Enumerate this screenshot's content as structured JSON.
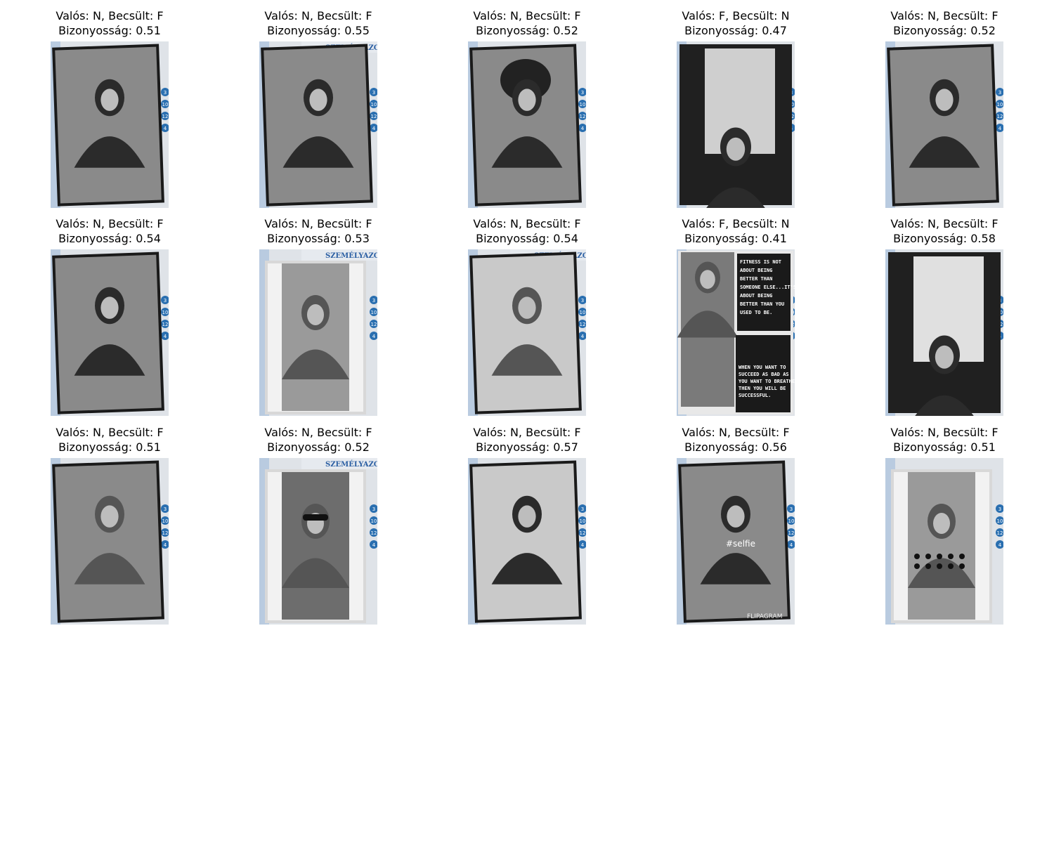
{
  "grid": {
    "rows": 3,
    "columns": 5,
    "items": [
      {
        "line1": "Valós: N, Becsült: F",
        "line2": "Bizonyosság: 0.51",
        "variant": "dark-hair-side"
      },
      {
        "line1": "Valós: N, Becsült: F",
        "line2": "Bizonyosság: 0.55",
        "variant": "id-header",
        "header": "SZEMÉLYAZONO"
      },
      {
        "line1": "Valós: N, Becsült: F",
        "line2": "Bizonyosság: 0.52",
        "variant": "hat"
      },
      {
        "line1": "Valós: F, Becsült: N",
        "line2": "Bizonyosság: 0.47",
        "variant": "window-light"
      },
      {
        "line1": "Valós: N, Becsült: F",
        "line2": "Bizonyosság: 0.52",
        "variant": "mirror-full"
      },
      {
        "line1": "Valós: N, Becsült: F",
        "line2": "Bizonyosság: 0.54",
        "variant": "lying"
      },
      {
        "line1": "Valós: N, Becsült: F",
        "line2": "Bizonyosság: 0.53",
        "variant": "id-header-white",
        "header": "SZEMÉLYAZONO"
      },
      {
        "line1": "Valós: N, Becsült: F",
        "line2": "Bizonyosság: 0.54",
        "variant": "blonde",
        "header": "SZEMÉLYAZONO"
      },
      {
        "line1": "Valós: F, Becsült: N",
        "line2": "Bizonyosság: 0.41",
        "variant": "poster",
        "poster_top": [
          "FITNESS IS NOT",
          "ABOUT BEING",
          "BETTER THAN",
          "SOMEONE ELSE...IT'S",
          "ABOUT BEING",
          "BETTER THAN YOU",
          "USED TO BE."
        ],
        "poster_bottom": [
          "WHEN YOU WANT TO",
          "SUCCEED AS BAD AS",
          "YOU WANT TO BREATHE,",
          "THEN YOU WILL BE",
          "SUCCESSFUL."
        ]
      },
      {
        "line1": "Valós: N, Becsült: F",
        "line2": "Bizonyosság: 0.58",
        "variant": "backlit"
      },
      {
        "line1": "Valós: N, Becsült: F",
        "line2": "Bizonyosság: 0.51",
        "variant": "portrait-frame"
      },
      {
        "line1": "Valós: N, Becsült: F",
        "line2": "Bizonyosság: 0.52",
        "variant": "sunglasses",
        "header": "SZEMÉLYAZONO"
      },
      {
        "line1": "Valós: N, Becsült: F",
        "line2": "Bizonyosság: 0.57",
        "variant": "lace"
      },
      {
        "line1": "Valós: N, Becsült: F",
        "line2": "Bizonyosság: 0.56",
        "variant": "child",
        "caption": "#selfie",
        "watermark": "FLIPAGRAM"
      },
      {
        "line1": "Valós: N, Becsült: F",
        "line2": "Bizonyosság: 0.51",
        "variant": "mirror-dots"
      }
    ]
  }
}
